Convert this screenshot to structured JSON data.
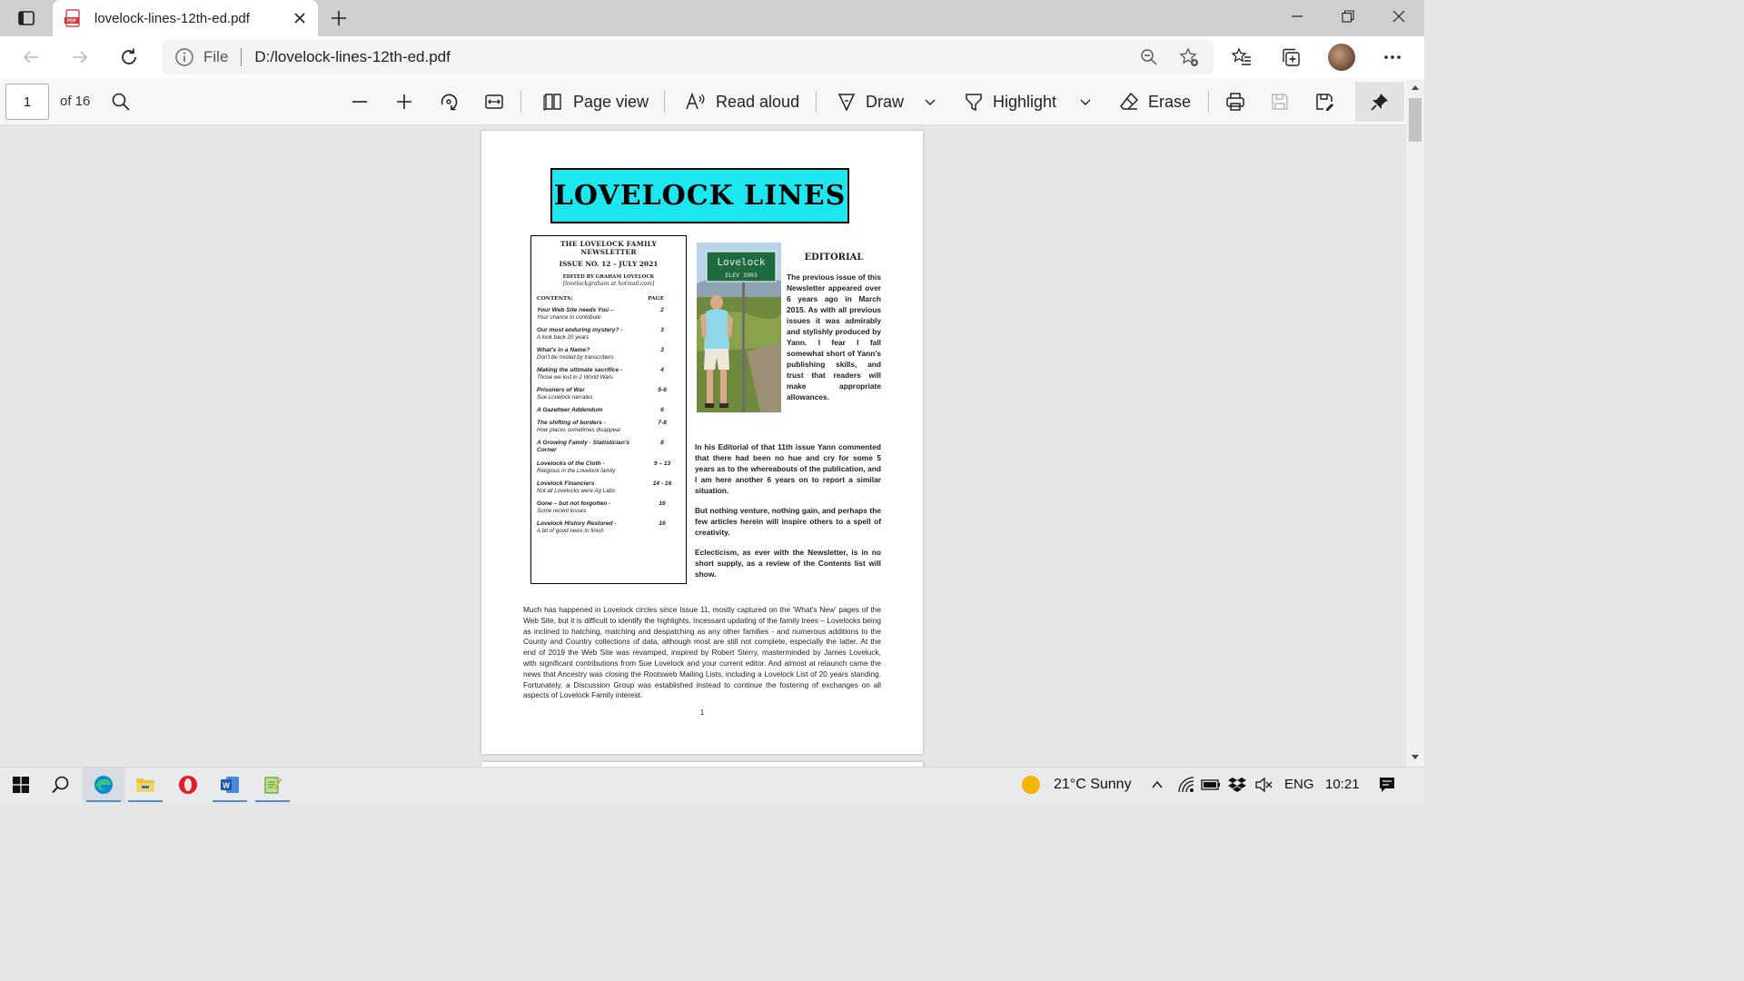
{
  "browser": {
    "tab_title": "lovelock-lines-12th-ed.pdf",
    "address_scheme": "File",
    "address_url": "D:/lovelock-lines-12th-ed.pdf"
  },
  "pdf_toolbar": {
    "page_number": "1",
    "page_total": "of 16",
    "page_view_label": "Page view",
    "read_aloud_label": "Read aloud",
    "draw_label": "Draw",
    "highlight_label": "Highlight",
    "erase_label": "Erase"
  },
  "document": {
    "masthead": "LOVELOCK LINES",
    "newsletter_title": "THE LOVELOCK FAMILY NEWSLETTER",
    "issue": "ISSUE NO. 12 – JULY 2021",
    "editor": "EDITED BY GRAHAM LOVELOCK",
    "email": "[lovelockgraham at hotmail.com]",
    "contents_label": "CONTENTS:",
    "page_label": "PAGE",
    "contents": [
      {
        "title": "Your Web Site needs You –",
        "subtitle": "Your chance to contribute",
        "page": "2"
      },
      {
        "title": "Our most enduring mystery? -",
        "subtitle": "A look back 20 years",
        "page": "3"
      },
      {
        "title": "What's in a Name?",
        "subtitle": "Don't be misled by transcribers",
        "page": "3"
      },
      {
        "title": "Making the ultimate sacrifice -",
        "subtitle": "Those we lost in 2 World Wars",
        "page": "4"
      },
      {
        "title": "Prisoners of War",
        "subtitle": "Sue Lovelock narrates",
        "page": "5-6"
      },
      {
        "title": "A Gazetteer Addendum",
        "subtitle": "",
        "page": "6"
      },
      {
        "title": "The shifting of borders -",
        "subtitle": "How places sometimes disappear",
        "page": "7-8"
      },
      {
        "title": "A Growing Family - Statistician's Corner",
        "subtitle": "",
        "page": "8"
      },
      {
        "title": "Lovelocks of the Cloth -",
        "subtitle": "Religious in the Lovelock family",
        "page": "9 – 13"
      },
      {
        "title": "Lovelock Financiers",
        "subtitle": "Not all Lovelocks were Ag Labs",
        "page": "14 - 16"
      },
      {
        "title": "Gone – but not forgotten -",
        "subtitle": "Some recent losses",
        "page": "16"
      },
      {
        "title": "Lovelock History Restored -",
        "subtitle": "A bit of good news to finish",
        "page": "16"
      }
    ],
    "sign_text": "Lovelock",
    "sign_elev": "ELEV   3903",
    "editorial_heading": "EDITORIAL",
    "editorial_p1": "The previous issue of this Newsletter appeared over 6 years ago in March 2015. As with all previous issues it was admirably and stylishly produced by Yann. I fear I fall somewhat short of Yann's publishing skills, and trust that readers will make appropriate allowances.",
    "editorial_p2": "In his Editorial of that 11th issue Yann commented that there had been no hue and cry for some 5 years as to the whereabouts of the publication, and I am here another 6 years on to report a similar situation.",
    "editorial_p3": "But nothing venture, nothing gain, and perhaps the few articles herein will inspire others to a spell of creativity.",
    "editorial_p4": "Eclecticism, as ever with the Newsletter, is in no short supply, as a review of the Contents list will show.",
    "body": "Much has happened in Lovelock circles since Issue 11, mostly captured on the 'What's New' pages of the Web Site, but it is difficult to identify the highlights. Incessant updating of the family trees – Lovelocks being as inclined to hatching, matching and despatching as any other families - and numerous additions to the County and Country collections of data, although most are still not complete, especially the latter. At the end of 2019 the Web Site was revamped, inspired by Robert Sterry, masterminded by James Loveluck, with significant contributions from Sue Lovelock and your current editor. And almost at relaunch came the news that Ancestry was closing the Rootsweb Mailing Lists, including a Lovelock List of 20 years standing. Fortunately, a Discussion Group was established instead to continue the fostering of exchanges on all aspects of Lovelock Family interest.",
    "page_footer": "1"
  },
  "taskbar": {
    "weather": "21°C  Sunny",
    "language": "ENG",
    "time": "10:21"
  },
  "colors": {
    "masthead_bg": "#1de7ee",
    "accent_blue": "#0078d4"
  },
  "icons": [
    "tab-actions-icon",
    "pdf-file-icon",
    "close-icon",
    "plus-icon",
    "minimize-icon",
    "restore-icon",
    "back-arrow-icon",
    "forward-arrow-icon",
    "refresh-icon",
    "info-icon",
    "zoom-out-icon",
    "add-favorite-icon",
    "favorites-icon",
    "collections-icon",
    "more-icon",
    "search-icon",
    "minus-icon",
    "rotate-icon",
    "fit-width-icon",
    "page-view-icon",
    "read-aloud-icon",
    "draw-icon",
    "chevron-down-icon",
    "highlight-icon",
    "erase-icon",
    "print-icon",
    "save-icon",
    "save-as-icon",
    "pin-icon",
    "windows-start-icon",
    "edge-icon",
    "file-explorer-icon",
    "opera-icon",
    "word-icon",
    "notepad-icon",
    "sun-icon",
    "wifi-icon",
    "battery-icon",
    "dropbox-icon",
    "volume-muted-icon",
    "notification-icon"
  ]
}
